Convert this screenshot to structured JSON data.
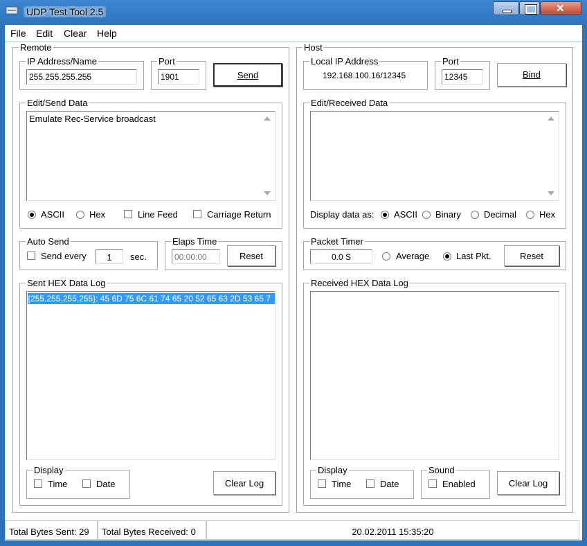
{
  "window": {
    "title": "UDP Test Tool 2.5"
  },
  "menu": [
    "File",
    "Edit",
    "Clear",
    "Help"
  ],
  "remote": {
    "group_label": "Remote",
    "ip_label": "IP Address/Name",
    "ip_value": "255.255.255.255",
    "port_label": "Port",
    "port_value": "1901",
    "send_button": "Send",
    "edit_label": "Edit/Send Data",
    "edit_value": "Emulate Rec-Service broadcast",
    "opt_ascii": "ASCII",
    "opt_hex": "Hex",
    "chk_line_feed": "Line Feed",
    "chk_carriage_return": "Carriage Return",
    "auto_send_label": "Auto Send",
    "send_every_label": "Send every",
    "send_every_value": "1",
    "sec_label": "sec.",
    "elaps_label": "Elaps Time",
    "elaps_value": "00:00:00",
    "reset_button": "Reset",
    "sent_log_label": "Sent HEX Data Log",
    "sent_log_line": "{255.255.255.255}: 45 6D 75 6C 61 74 65 20 52 65 63 2D 53 65 7",
    "display_label": "Display",
    "chk_time": "Time",
    "chk_date": "Date",
    "clear_log_button": "Clear Log"
  },
  "host": {
    "group_label": "Host",
    "local_ip_label": "Local IP Address",
    "local_ip_value": "192.168.100.16/12345",
    "port_label": "Port",
    "port_value": "12345",
    "bind_button": "Bind",
    "edit_label": "Edit/Received Data",
    "display_as_label": "Display data as:",
    "opt_ascii": "ASCII",
    "opt_binary": "Binary",
    "opt_decimal": "Decimal",
    "opt_hex": "Hex",
    "packet_timer_label": "Packet Timer",
    "packet_timer_value": "0.0 S",
    "opt_average": "Average",
    "opt_last": "Last Pkt.",
    "reset_button": "Reset",
    "recv_log_label": "Received HEX Data Log",
    "display_label": "Display",
    "chk_time": "Time",
    "chk_date": "Date",
    "sound_label": "Sound",
    "chk_enabled": "Enabled",
    "clear_log_button": "Clear Log"
  },
  "status": {
    "bytes_sent": "Total Bytes Sent: 29",
    "bytes_received": "Total Bytes Received: 0",
    "datetime": "20.02.2011 15:35:20"
  },
  "colors": {
    "accent": "#3399ff",
    "frame": "#2c72bd"
  }
}
